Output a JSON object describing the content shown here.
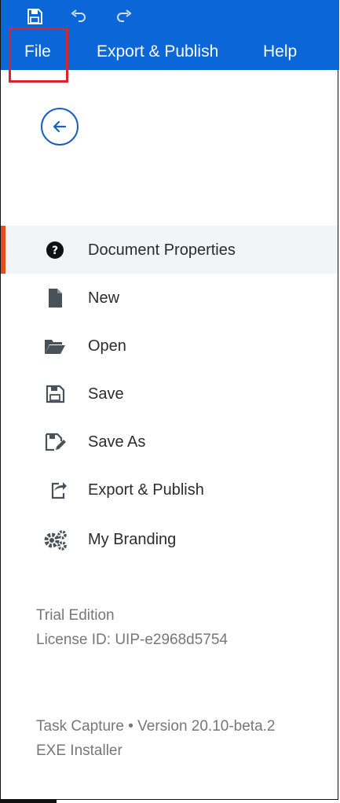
{
  "topbar": {
    "bg_color": "#0b66d8",
    "quick_access": [
      {
        "name": "save-icon"
      },
      {
        "name": "undo-icon"
      },
      {
        "name": "redo-icon"
      }
    ],
    "menu": [
      {
        "label": "File"
      },
      {
        "label": "Export & Publish"
      },
      {
        "label": "Help"
      }
    ],
    "highlight_color": "#d9232e"
  },
  "back_button": {
    "icon": "arrow-left-icon",
    "color": "#1a5fc6"
  },
  "nav": {
    "active_accent": "#e24f1d",
    "items": [
      {
        "label": "Document Properties",
        "icon": "question-circle-icon",
        "active": true
      },
      {
        "label": "New",
        "icon": "file-icon",
        "active": false
      },
      {
        "label": "Open",
        "icon": "folder-open-icon",
        "active": false
      },
      {
        "label": "Save",
        "icon": "floppy-icon",
        "active": false
      },
      {
        "label": "Save As",
        "icon": "floppy-pencil-icon",
        "active": false
      },
      {
        "label": "Export & Publish",
        "icon": "share-icon",
        "active": false
      },
      {
        "label": "My Branding",
        "icon": "gears-icon",
        "active": false
      }
    ]
  },
  "footer": {
    "edition": "Trial Edition",
    "license": "License ID: UIP-e2968d5754",
    "version": "Task Capture • Version 20.10-beta.2",
    "installer": "EXE Installer"
  }
}
